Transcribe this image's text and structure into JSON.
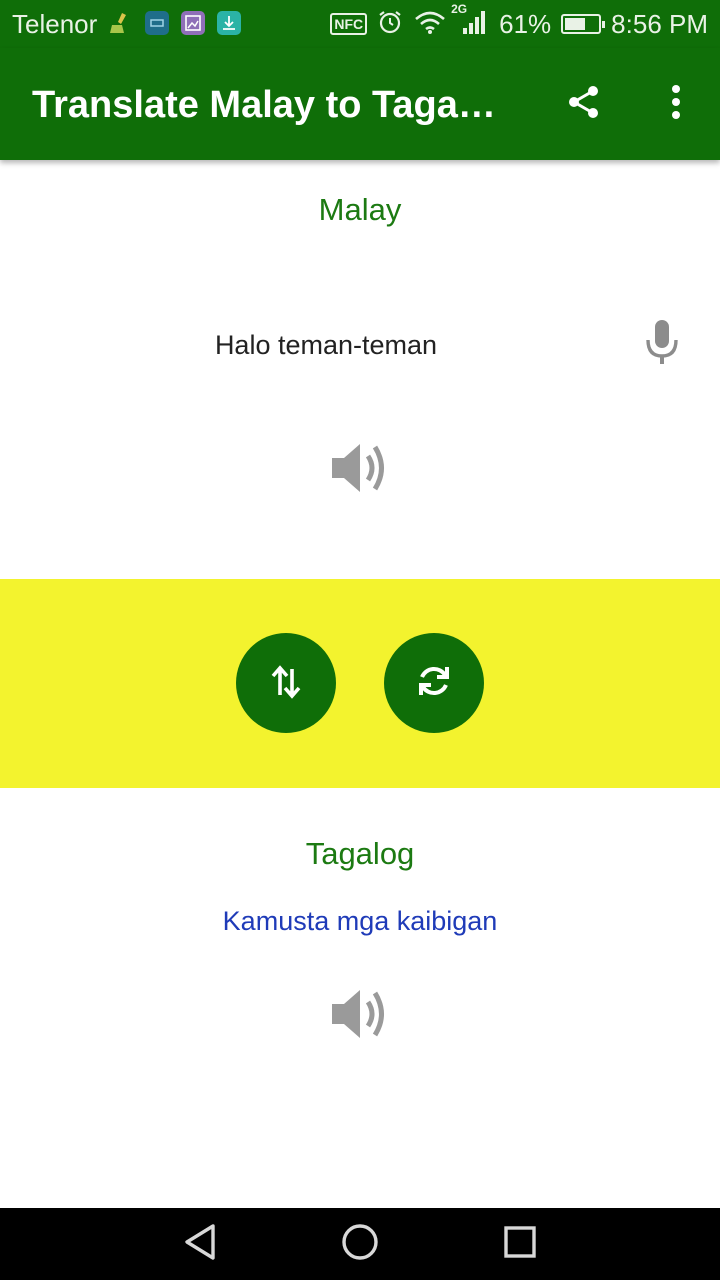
{
  "status_bar": {
    "carrier": "Telenor",
    "network": "2G",
    "battery_percent": "61%",
    "battery_level": 0.61,
    "time": "8:56 PM",
    "icons": [
      "broom-notification-icon",
      "app-notification-icon",
      "image-notification-icon",
      "download-notification-icon",
      "nfc-icon",
      "alarm-icon",
      "wifi-icon",
      "signal-icon",
      "battery-icon"
    ]
  },
  "toolbar": {
    "title": "Translate Malay to Tagal…",
    "actions": [
      "share-icon",
      "more-vert-icon"
    ]
  },
  "source": {
    "language": "Malay",
    "text": "Halo teman-teman",
    "icons": [
      "microphone-icon",
      "speaker-icon"
    ]
  },
  "actions": {
    "background": "#f3f32e",
    "button_color": "#0f6e08",
    "buttons": [
      "swap-languages-icon",
      "refresh-translate-icon"
    ]
  },
  "target": {
    "language": "Tagalog",
    "text": "Kamusta mga kaibigan",
    "icons": [
      "speaker-icon"
    ]
  },
  "colors": {
    "primary": "#0f6e08",
    "label_green": "#1c7a12",
    "translation_blue": "#1f3bb8",
    "panel_yellow": "#f3f32e"
  },
  "nav_bar": {
    "buttons": [
      "back-icon",
      "home-icon",
      "recents-icon"
    ]
  }
}
